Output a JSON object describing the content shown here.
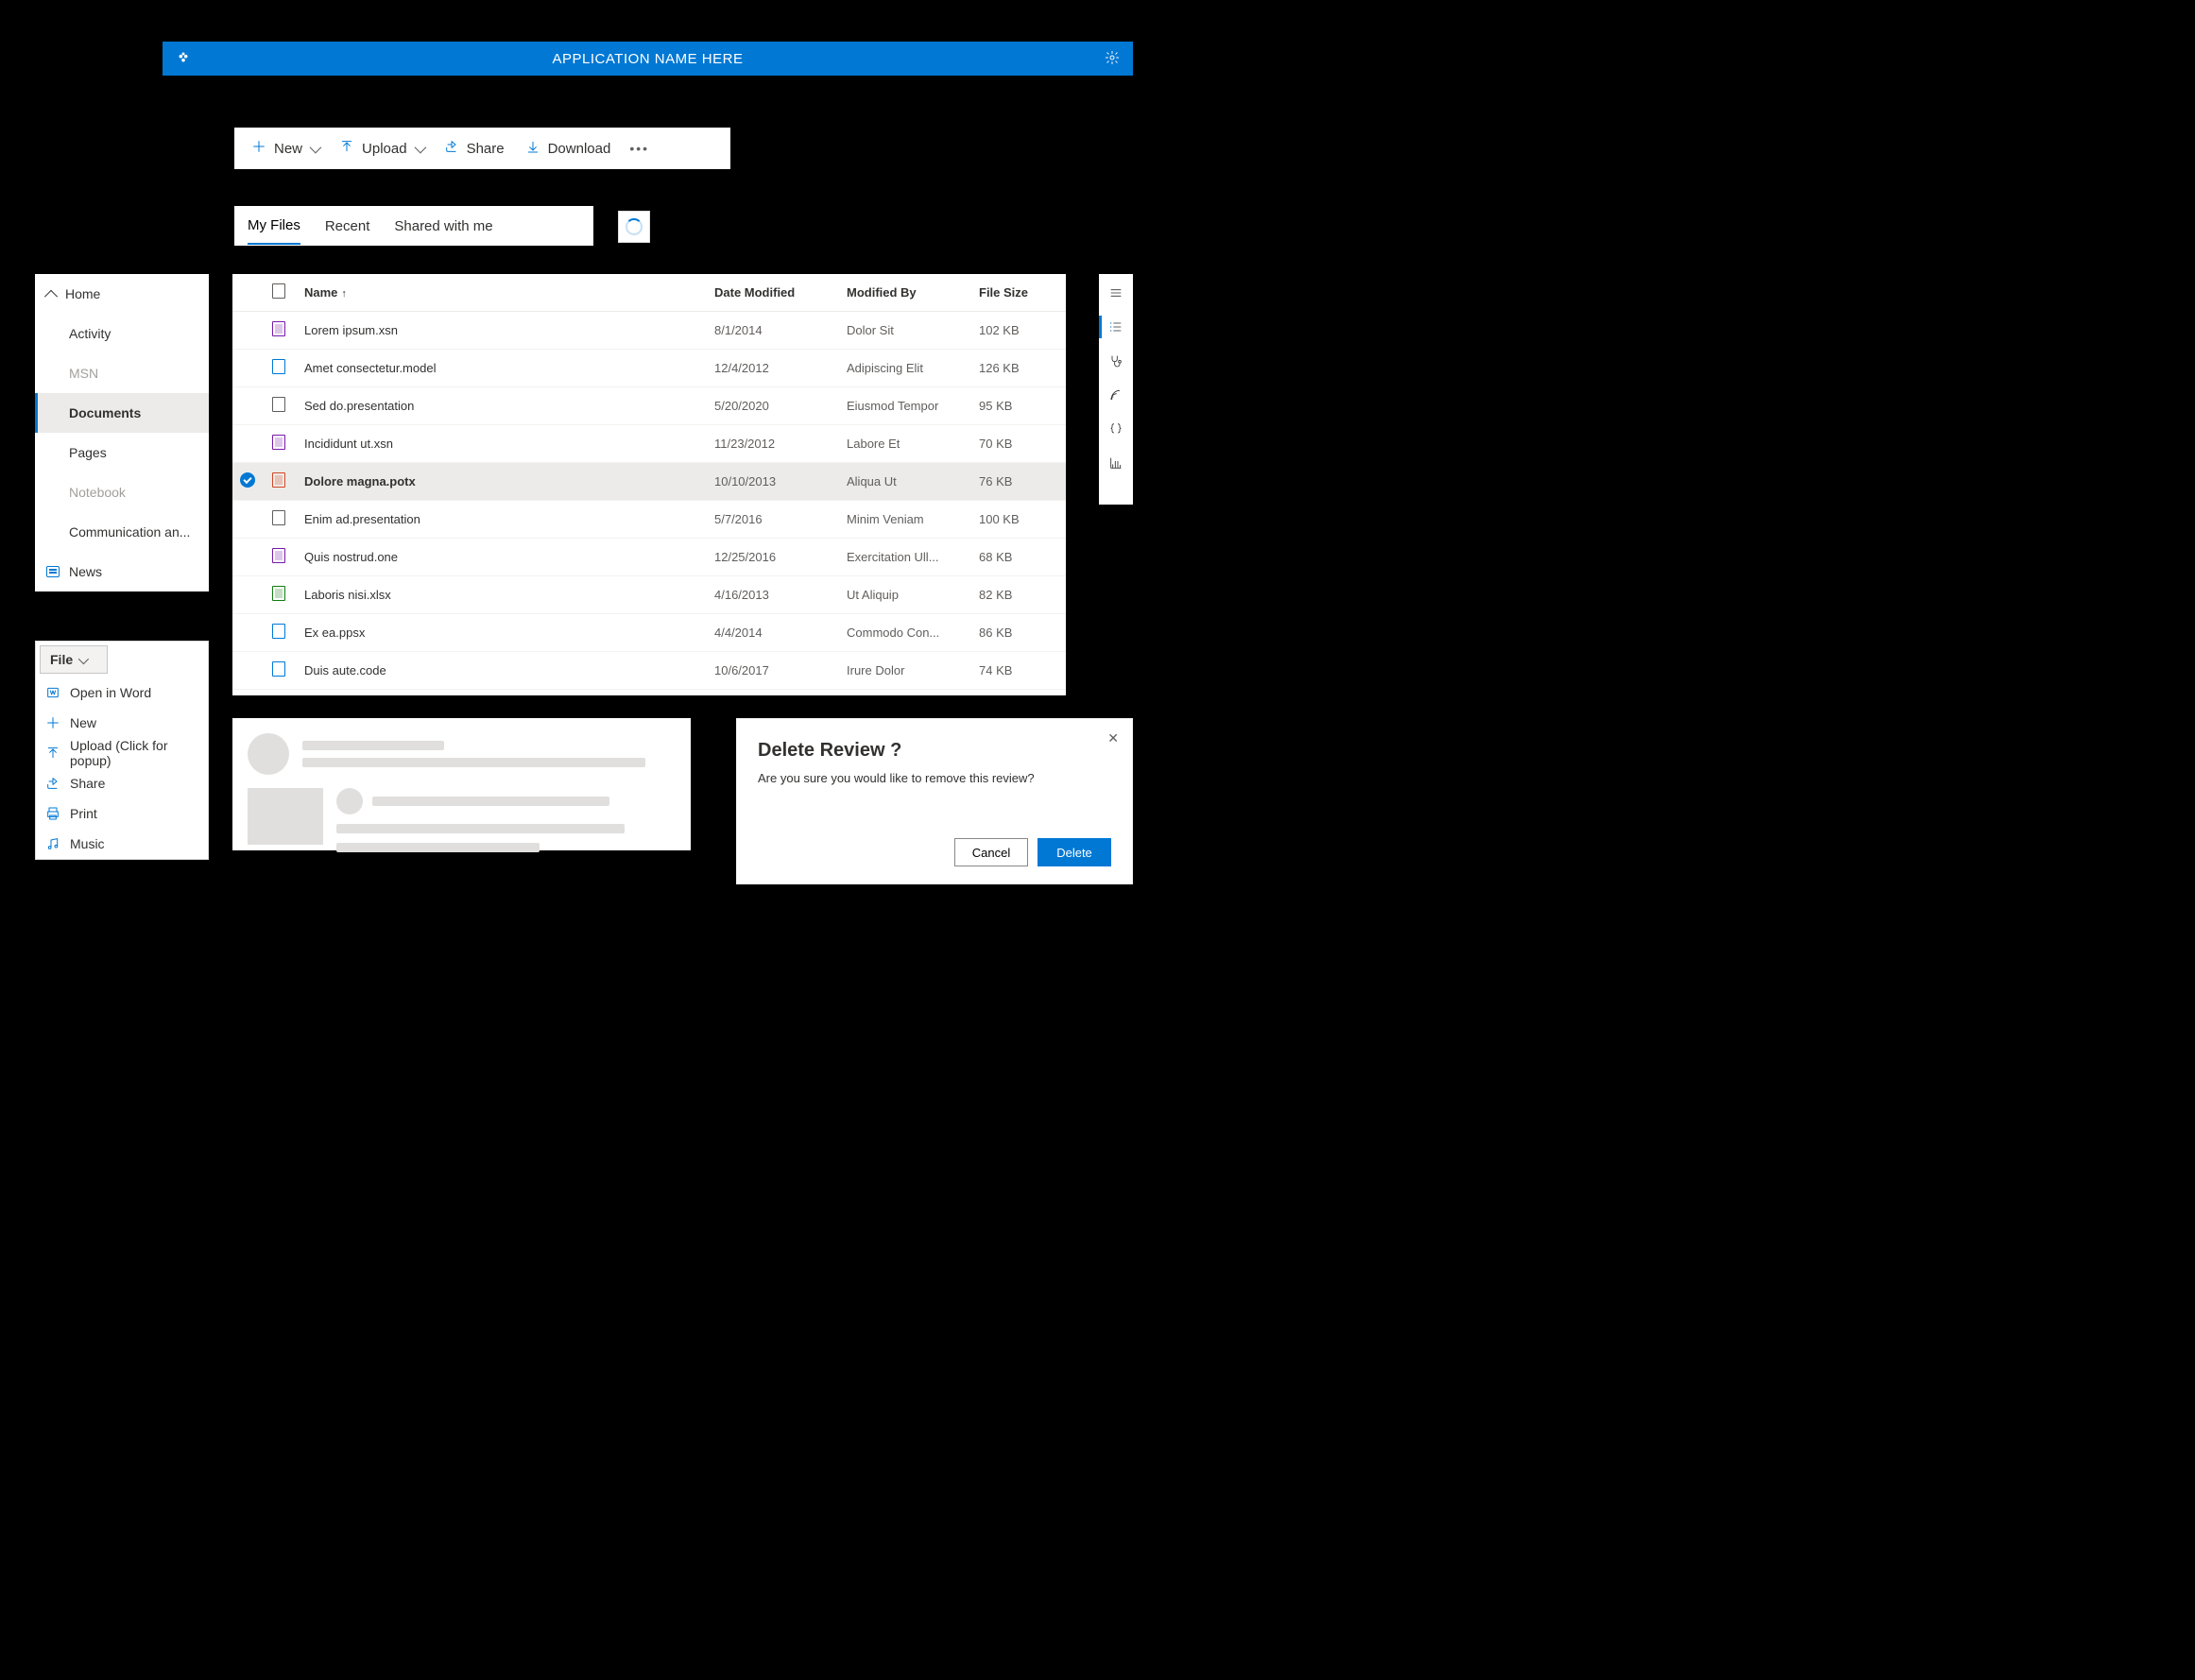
{
  "header": {
    "title": "APPLICATION NAME HERE"
  },
  "commandBar": {
    "new": "New",
    "upload": "Upload",
    "share": "Share",
    "download": "Download"
  },
  "tabs": [
    "My Files",
    "Recent",
    "Shared with me"
  ],
  "activeTab": 0,
  "nav": {
    "home": "Home",
    "items": [
      {
        "label": "Activity",
        "disabled": false
      },
      {
        "label": "MSN",
        "disabled": true
      },
      {
        "label": "Documents",
        "selected": true
      },
      {
        "label": "Pages",
        "disabled": false
      },
      {
        "label": "Notebook",
        "disabled": true
      },
      {
        "label": "Communication an...",
        "disabled": false
      }
    ],
    "news": "News"
  },
  "fileList": {
    "columns": {
      "name": "Name",
      "modified": "Date Modified",
      "by": "Modified By",
      "size": "File Size"
    },
    "rows": [
      {
        "icon": "purple",
        "name": "Lorem ipsum.xsn",
        "modified": "8/1/2014",
        "by": "Dolor Sit",
        "size": "102 KB"
      },
      {
        "icon": "blue",
        "name": "Amet consectetur.model",
        "modified": "12/4/2012",
        "by": "Adipiscing Elit",
        "size": "126 KB"
      },
      {
        "icon": "",
        "name": "Sed do.presentation",
        "modified": "5/20/2020",
        "by": "Eiusmod Tempor",
        "size": "95 KB"
      },
      {
        "icon": "purple",
        "name": "Incididunt ut.xsn",
        "modified": "11/23/2012",
        "by": "Labore Et",
        "size": "70 KB"
      },
      {
        "icon": "orange",
        "name": "Dolore magna.potx",
        "modified": "10/10/2013",
        "by": "Aliqua Ut",
        "size": "76 KB",
        "selected": true
      },
      {
        "icon": "",
        "name": "Enim ad.presentation",
        "modified": "5/7/2016",
        "by": "Minim Veniam",
        "size": "100 KB"
      },
      {
        "icon": "purple",
        "name": "Quis nostrud.one",
        "modified": "12/25/2016",
        "by": "Exercitation Ull...",
        "size": "68 KB"
      },
      {
        "icon": "green",
        "name": "Laboris nisi.xlsx",
        "modified": "4/16/2013",
        "by": "Ut Aliquip",
        "size": "82 KB"
      },
      {
        "icon": "blue",
        "name": "Ex ea.ppsx",
        "modified": "4/4/2014",
        "by": "Commodo Con...",
        "size": "86 KB"
      },
      {
        "icon": "blue",
        "name": "Duis aute.code",
        "modified": "10/6/2017",
        "by": "Irure Dolor",
        "size": "74 KB"
      }
    ]
  },
  "railIcons": [
    "menu",
    "list",
    "stethoscope",
    "signal",
    "braces",
    "chart"
  ],
  "fileMenu": {
    "title": "File",
    "items": [
      {
        "icon": "word",
        "label": "Open in Word"
      },
      {
        "icon": "plus",
        "label": "New"
      },
      {
        "icon": "upload",
        "label": "Upload (Click for popup)"
      },
      {
        "icon": "share",
        "label": "Share"
      },
      {
        "icon": "print",
        "label": "Print"
      },
      {
        "icon": "music",
        "label": "Music"
      }
    ]
  },
  "dialog": {
    "title": "Delete Review ?",
    "body": "Are you sure you would like to remove this review?",
    "cancel": "Cancel",
    "confirm": "Delete"
  }
}
